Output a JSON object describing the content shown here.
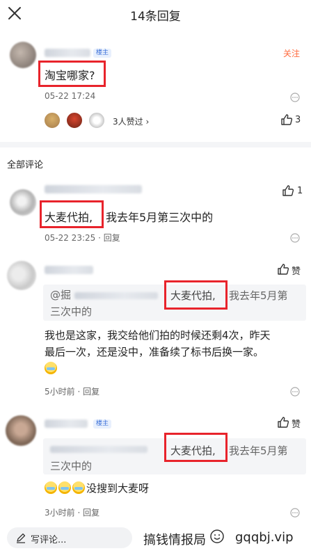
{
  "header": {
    "title": "14条回复"
  },
  "post": {
    "badge": "楼主",
    "follow_label": "关注",
    "text": "淘宝哪家?",
    "timestamp": "05-22 17:24",
    "likes_text": "3人赞过 ›",
    "like_count": "3"
  },
  "section_title": "全部评论",
  "comments": [
    {
      "text_highlight": "大麦代拍,",
      "text_rest": "我去年5月第三次中的",
      "meta": "05-22 23:25 · 回复",
      "like_count": "1"
    },
    {
      "like_label": "赞",
      "quote_highlight": "大麦代拍,",
      "quote_rest_1": "我去年5月第",
      "quote_rest_2": "三次中的",
      "quote_prefix": "@掘",
      "body_line_1": "我也是这家，我交给他们拍的时候还剩4次，昨天",
      "body_line_2": "最后一次，还是没中，准备续了标书后换一家。",
      "meta": "5小时前 · 回复"
    },
    {
      "badge": "楼主",
      "like_label": "赞",
      "quote_highlight": "大麦代拍,",
      "quote_rest_1": "我去年5月第",
      "quote_rest_2": "三次中的",
      "body_text": "没搜到大麦呀",
      "meta": "3小时前 · 回复"
    }
  ],
  "bottom": {
    "placeholder": "写评论...",
    "watermark_left": "搞钱情报局",
    "watermark_right": "gqqbj.vip"
  }
}
